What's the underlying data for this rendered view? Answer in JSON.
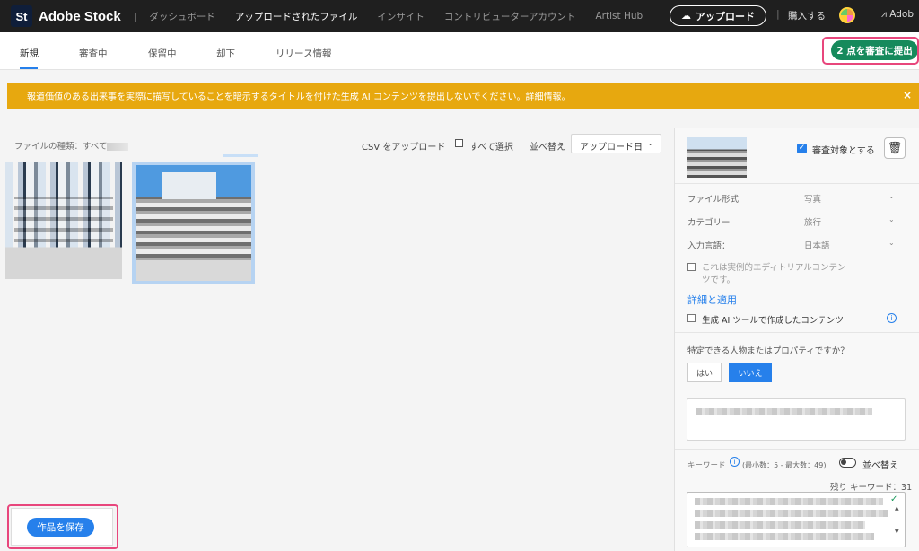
{
  "header": {
    "logo": "St",
    "brand": "Adobe Stock",
    "nav": [
      {
        "label": "ダッシュボード",
        "active": false
      },
      {
        "label": "アップロードされたファイル",
        "active": true
      },
      {
        "label": "インサイト",
        "active": false
      },
      {
        "label": "コントリビューターアカウント",
        "active": false
      },
      {
        "label": "Artist Hub",
        "active": false
      }
    ],
    "upload_label": "アップロード",
    "buy_label": "購入する",
    "adobe_label": "Adob"
  },
  "tabs": {
    "items": [
      "新規",
      "審査中",
      "保留中",
      "却下",
      "リリース情報"
    ],
    "active_index": 0,
    "submit_label": "2 点を審査に提出"
  },
  "banner": {
    "text": "報道価値のある出来事を実際に描写していることを暗示するタイトルを付けた生成 AI コンテンツを提出しないでください。",
    "link": "詳細情報",
    "suffix": "。",
    "close": "×"
  },
  "toolbar": {
    "file_type_label": "ファイルの種類：すべて",
    "csv_label": "CSV をアップロード",
    "select_all_label": "すべて選択",
    "sort_label": "並べ替え",
    "sort_value": "アップロード日"
  },
  "save_label": "作品を保存",
  "panel": {
    "review_label": "審査対象とする",
    "fields": [
      {
        "label": "ファイル形式",
        "value": "写真"
      },
      {
        "label": "カテゴリー",
        "value": "旅行"
      },
      {
        "label": "入力言語：",
        "value": "日本語"
      }
    ],
    "editorial_label": "これは実例的エディトリアルコンテンツです。",
    "details_link": "詳細と適用",
    "genai_label": "生成 AI ツールで作成したコンテンツ",
    "person_question": "特定できる人物またはプロパティですか？",
    "yes_label": "はい",
    "no_label": "いいえ",
    "keywords_label": "キーワード",
    "keywords_count": "(最小数：5 - 最大数：49)",
    "sort_toggle_label": "並べ替え",
    "remaining_label": "残り キーワード：31"
  },
  "colors": {
    "accent": "#2680eb",
    "submit": "#168a5c",
    "banner": "#e7a80f",
    "highlight": "#e8467c"
  }
}
